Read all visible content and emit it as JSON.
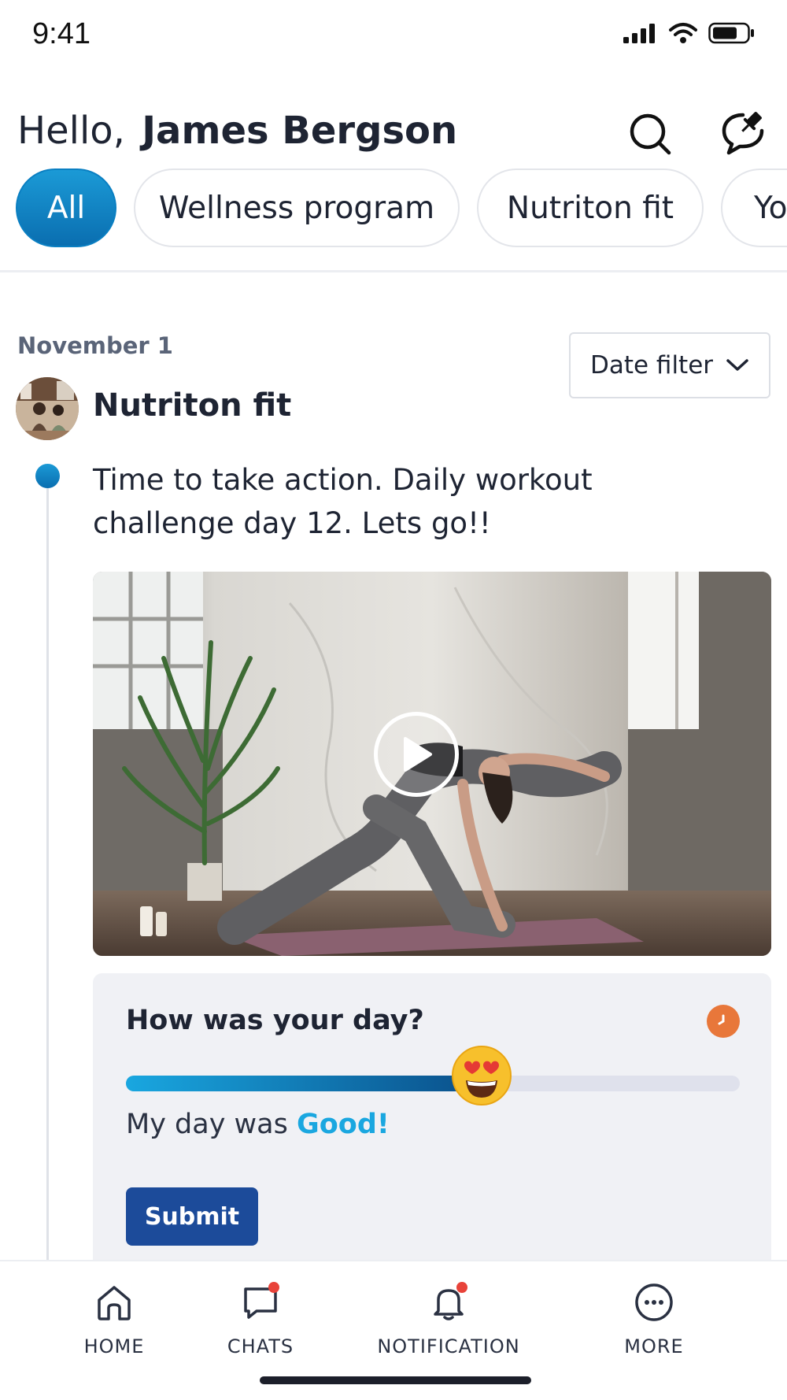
{
  "status_bar": {
    "time": "9:41",
    "icons": [
      "signal-icon",
      "wifi-icon",
      "battery-icon"
    ]
  },
  "header": {
    "greeting": "Hello,",
    "user_name": "James Bergson",
    "icons": [
      "search-icon",
      "chat-pin-icon"
    ]
  },
  "filters": {
    "chips": [
      "All",
      "Wellness program",
      "Nutriton fit",
      "Yo"
    ],
    "selected": "All"
  },
  "feed": {
    "date": "November 1",
    "date_filter_label": "Date filter",
    "post": {
      "author": "Nutriton fit",
      "text": "Time to take action. Daily workout challenge day 12. Lets go!!",
      "media": "yoga workout video"
    }
  },
  "mood_card": {
    "question": "How was your day?",
    "result_prefix": "My day was",
    "result_value": "Good!",
    "slider_level": 0.58,
    "submit_label": "Submit"
  },
  "bottom_nav": {
    "items": [
      {
        "label": "HOME",
        "icon": "home-icon"
      },
      {
        "label": "CHATS",
        "icon": "chat-icon",
        "badge": true
      },
      {
        "label": "NOTIFICATION",
        "icon": "bell-icon",
        "badge": true
      },
      {
        "label": "MORE",
        "icon": "more-icon"
      }
    ]
  },
  "colors": {
    "primary": "#0a7fc2",
    "submit": "#1c4b9a",
    "accent_good": "#1aa7e0",
    "badge": "#e8433a",
    "clock": "#e8773a"
  }
}
